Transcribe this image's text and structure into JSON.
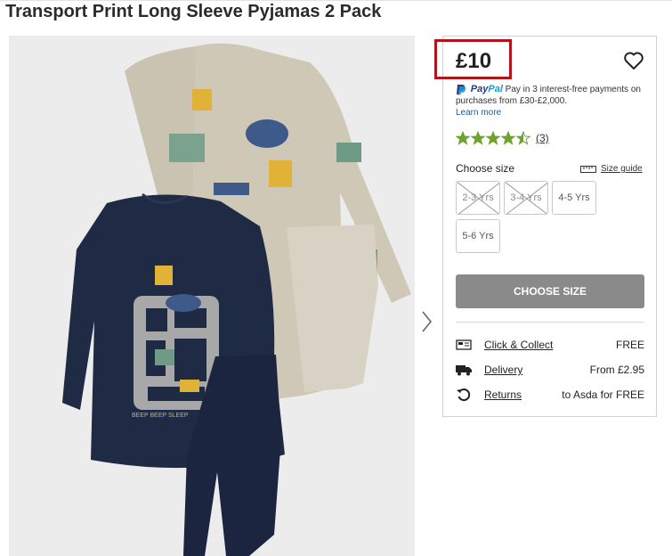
{
  "product": {
    "title": "Transport Print Long Sleeve Pyjamas 2 Pack",
    "price": "£10"
  },
  "paypal": {
    "brand_pay": "Pay",
    "brand_pal": "Pal",
    "message": "Pay in 3 interest-free payments on purchases from £30-£2,000.",
    "learn_more": "Learn more"
  },
  "rating": {
    "stars": 4.5,
    "max": 5,
    "count_text": "(3)",
    "star_color": "#6fa32b"
  },
  "size": {
    "heading": "Choose size",
    "guide_label": "Size guide",
    "options": [
      {
        "label": "2-3 Yrs",
        "available": false
      },
      {
        "label": "3-4 Yrs",
        "available": false
      },
      {
        "label": "4-5 Yrs",
        "available": true
      },
      {
        "label": "5-6 Yrs",
        "available": true
      }
    ],
    "cta": "CHOOSE SIZE"
  },
  "services": [
    {
      "icon": "click-collect-icon",
      "label": "Click & Collect",
      "value": "FREE"
    },
    {
      "icon": "delivery-truck-icon",
      "label": "Delivery",
      "value": "From £2.95"
    },
    {
      "icon": "returns-icon",
      "label": "Returns",
      "value": "to Asda for FREE"
    }
  ],
  "image": {
    "alt_print_text": "BEEP BEEP SLEEP"
  },
  "colors": {
    "price_highlight": "#b3131b",
    "navy": "#1f2a44",
    "beige": "#cfc8b7",
    "cta_grey": "#8a8a8a"
  }
}
